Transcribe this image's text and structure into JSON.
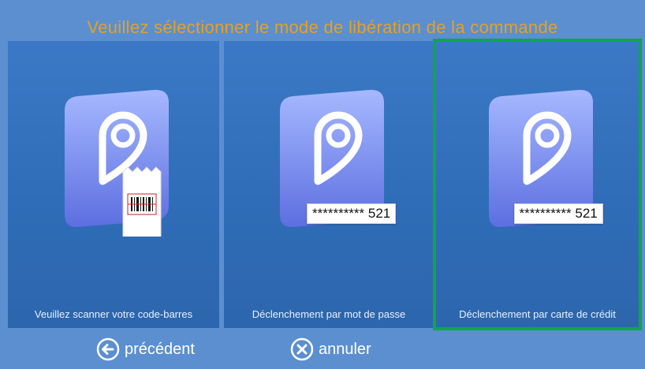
{
  "header": {
    "title": "Veuillez sélectionner le mode de libération de la commande"
  },
  "options": [
    {
      "label": "Veuillez scanner votre code-barres",
      "icon": "barcode-ticket-icon"
    },
    {
      "label": "Déclenchement par mot de passe",
      "icon": "password-icon",
      "masked_value": "********** 521"
    },
    {
      "label": "Déclenchement par carte de crédit",
      "icon": "credit-card-icon",
      "masked_value": "********** 521",
      "selected": true
    }
  ],
  "footer": {
    "previous_label": "précédent",
    "cancel_label": "annuler"
  },
  "colors": {
    "background": "#5b8fd0",
    "tile": "#2f6cb7",
    "title": "#e8a020",
    "selected_outline": "#12a44a"
  }
}
